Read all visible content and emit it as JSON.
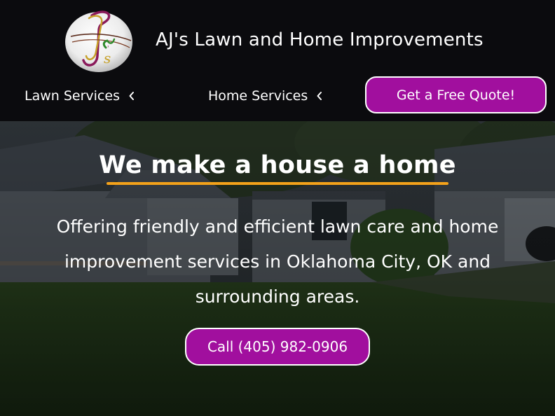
{
  "header": {
    "brand_name": "AJ's Lawn and Home Improvements",
    "logo_icon": "aj-monogram-logo-icon",
    "nav": [
      {
        "label": "Lawn Services",
        "icon": "chevron-left-icon"
      },
      {
        "label": "Home Services",
        "icon": "chevron-left-icon"
      }
    ],
    "quote_button": "Get a Free Quote!"
  },
  "hero": {
    "title": "We make a house a home",
    "description": "Offering friendly and efficient lawn care and home improvement services in Oklahoma City, OK and surrounding areas.",
    "call_button": "Call (405) 982-0906"
  },
  "colors": {
    "header_bg": "#0b0b0e",
    "button_bg": "#a10f9e",
    "accent_underline": "#f4a21a",
    "text": "#ffffff"
  }
}
